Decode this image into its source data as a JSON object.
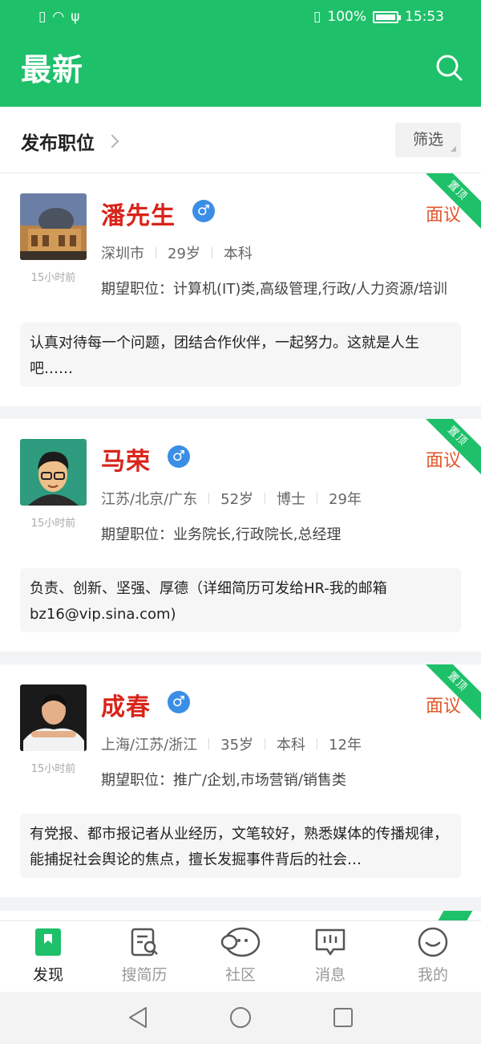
{
  "status": {
    "battery_percent": "100%",
    "time": "15:53"
  },
  "header": {
    "title": "最新"
  },
  "subbar": {
    "publish_label": "发布职位",
    "filter_label": "筛选"
  },
  "cards": [
    {
      "name": "潘先生",
      "gender_symbol": "♂",
      "salary": "面议",
      "badge": "置顶",
      "time": "15小时前",
      "meta": [
        "深圳市",
        "29岁",
        "本科"
      ],
      "expect": "期望职位：计算机(IT)类,高级管理,行政/人力资源/培训",
      "intro": "认真对待每一个问题，团结合作伙伴，一起努力。这就是人生吧……"
    },
    {
      "name": "马荣",
      "gender_symbol": "♂",
      "salary": "面议",
      "badge": "置顶",
      "time": "15小时前",
      "meta": [
        "江苏/北京/广东",
        "52岁",
        "博士",
        "29年"
      ],
      "expect": "期望职位：业务院长,行政院长,总经理",
      "intro": "负责、创新、坚强、厚德（详细简历可发给HR-我的邮箱bz16@vip.sina.com)"
    },
    {
      "name": "成春",
      "gender_symbol": "♂",
      "salary": "面议",
      "badge": "置顶",
      "time": "15小时前",
      "meta": [
        "上海/江苏/浙江",
        "35岁",
        "本科",
        "12年"
      ],
      "expect": "期望职位：推广/企划,市场营销/销售类",
      "intro": "有党报、都市报记者从业经历，文笔较好，熟悉媒体的传播规律，能捕捉社会舆论的焦点，擅长发掘事件背后的社会…"
    }
  ],
  "tabs": [
    {
      "label": "发现",
      "icon": "bookmark-icon",
      "active": true
    },
    {
      "label": "搜简历",
      "icon": "resume-search-icon"
    },
    {
      "label": "社区",
      "icon": "community-icon"
    },
    {
      "label": "消息",
      "icon": "message-icon"
    },
    {
      "label": "我的",
      "icon": "profile-icon"
    }
  ],
  "colors": {
    "brand": "#1ec06a",
    "name": "#d9241b",
    "salary": "#e0582c",
    "gender": "#3a8ee6"
  }
}
